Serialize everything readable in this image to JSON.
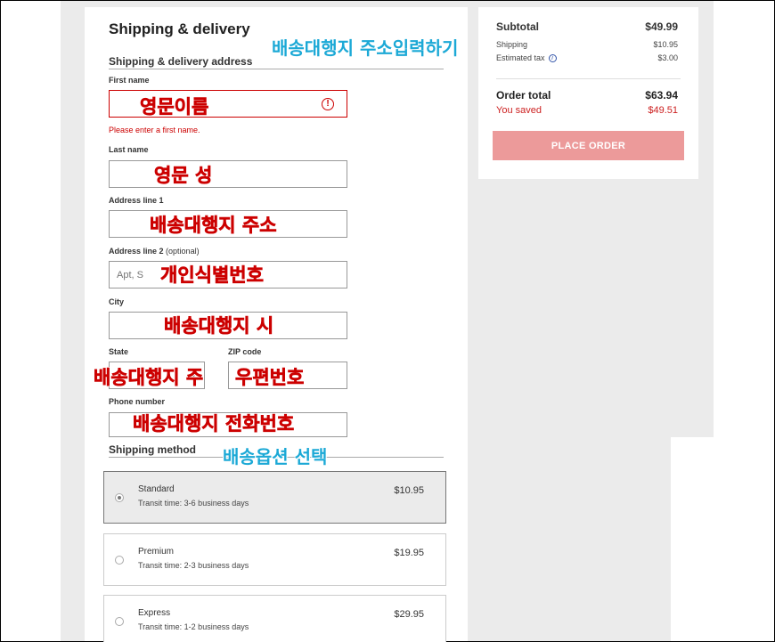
{
  "form": {
    "title": "Shipping & delivery",
    "address_section": "Shipping & delivery address",
    "first_name_label": "First name",
    "first_name_error": "Please enter a first name.",
    "last_name_label": "Last name",
    "address1_label": "Address line 1",
    "address2_label": "Address line 2",
    "address2_optional": "(optional)",
    "address2_placeholder": "Apt, S",
    "city_label": "City",
    "state_label": "State",
    "zip_label": "ZIP code",
    "phone_label": "Phone number",
    "shipping_method_section": "Shipping method"
  },
  "shipping_options": [
    {
      "name": "Standard",
      "transit": "Transit time: 3-6 business days",
      "price": "$10.95",
      "selected": true
    },
    {
      "name": "Premium",
      "transit": "Transit time: 2-3 business days",
      "price": "$19.95",
      "selected": false
    },
    {
      "name": "Express",
      "transit": "Transit time: 1-2 business days",
      "price": "$29.95",
      "selected": false
    }
  ],
  "summary": {
    "subtotal_label": "Subtotal",
    "subtotal_value": "$49.99",
    "shipping_label": "Shipping",
    "shipping_value": "$10.95",
    "tax_label": "Estimated tax",
    "tax_value": "$3.00",
    "order_total_label": "Order total",
    "order_total_value": "$63.94",
    "saved_label": "You saved",
    "saved_value": "$49.51",
    "place_order": "PLACE ORDER"
  },
  "annotations": {
    "address_input": "배송대행지 주소입력하기",
    "first_name": "영문이름",
    "last_name": "영문 성",
    "address1": "배송대행지 주소",
    "address2": "개인식별번호",
    "city": "배송대행지 시",
    "state": "배송대행지 주",
    "zip": "우편번호",
    "phone": "배송대행지 전화번호",
    "shipping_method": "배송옵션 선택"
  },
  "colors": {
    "error_red": "#cc0000",
    "button_pink": "#ec9a9a",
    "annotation_blue": "#1ca9d6",
    "page_gray": "#ebebeb"
  }
}
